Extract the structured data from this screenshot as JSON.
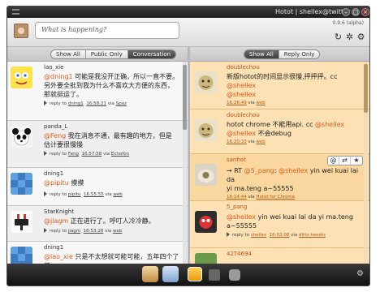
{
  "window": {
    "title": "Hotot | shellex@twitter",
    "version": "0.9.6 (alpha)"
  },
  "composer": {
    "placeholder": "What is happening?"
  },
  "left_tabs": [
    "Show All",
    "Public Only",
    "Conversation"
  ],
  "right_tabs": [
    "Show All",
    "Reply Only"
  ],
  "left_items": [
    {
      "user": "lao_xie",
      "lines": [
        "@dning1 可能是我没开正确，所以一直不要。",
        "另外要全批到我为什么不喜欢大方便的东西，",
        "那就挺运了。"
      ],
      "meta": {
        "prefix": "reply to",
        "to": "dning1",
        "time": "16:58:21",
        "via": "via",
        "client": "Spaz"
      }
    },
    {
      "user": "panda_L",
      "lines": [
        "@Feng 我在消息不通，最有趣的地方，但是",
        "估计要很慢慢"
      ],
      "meta": {
        "prefix": "reply to",
        "to": "Feng",
        "time": "16:57:58",
        "via": "via",
        "client": "Echofon"
      }
    },
    {
      "user": "dning1",
      "lines": [
        "@pipitu 摸摸"
      ],
      "meta": {
        "prefix": "reply to",
        "to": "pipitu",
        "time": "16:55:55",
        "via": "via",
        "client": "web"
      }
    },
    {
      "user": "StarKnight",
      "lines": [
        "@jiagm 正在进行了。呼叮人冷冷静。"
      ],
      "meta": {
        "prefix": "reply to",
        "to": "jiagm",
        "time": "16:53:28",
        "via": "via",
        "client": "web"
      }
    },
    {
      "user": "dning1",
      "lines": [
        "@lao_xie 只是不太想就可能可能，五年四个了了"
      ],
      "meta": {
        "prefix": "reply to",
        "to": "",
        "time": "",
        "via": "",
        "client": ""
      }
    }
  ],
  "right_items": [
    {
      "user": "doublechou",
      "lines": [
        "新版hotot的时间显示很慢,抨抨抨。cc @shellex",
        "@shellex"
      ],
      "meta": {
        "prefix": "",
        "to": "",
        "time": "16:26:49",
        "via": "via",
        "client": "web"
      }
    },
    {
      "user": "doublechou",
      "lines": [
        "hotot chrome 不能用api. cc @shellex",
        "@shellex 不会debug"
      ],
      "meta": {
        "prefix": "",
        "to": "",
        "time": "16:20:33",
        "via": "via",
        "client": "web"
      }
    },
    {
      "user": "sanhot",
      "lines": [
        "→ RT @5_pang: @shellex yin wei kuai lai da",
        "yi ma.teng a~55555"
      ],
      "meta": {
        "prefix": "",
        "to": "",
        "time": "16:14:44",
        "via": "via",
        "client": "Hotot for Chrome"
      }
    },
    {
      "user": "5_pang",
      "lines": [
        "@shellex yin wei kuai lai da yi ma.teng",
        "a~55555"
      ],
      "meta": {
        "prefix": "reply to",
        "to": "shellex",
        "time": "16:02:08",
        "via": "via",
        "client": "ditto tweets"
      }
    },
    {
      "user": "42T4694",
      "lines": [],
      "meta": {
        "prefix": "",
        "to": "",
        "time": "",
        "via": "",
        "client": ""
      }
    }
  ],
  "actions": [
    "@",
    "⇄",
    "★"
  ],
  "colors": {
    "mention": "#e15b1a",
    "right_bg": "#fbe1b4",
    "dock": "#1c1c1c"
  }
}
